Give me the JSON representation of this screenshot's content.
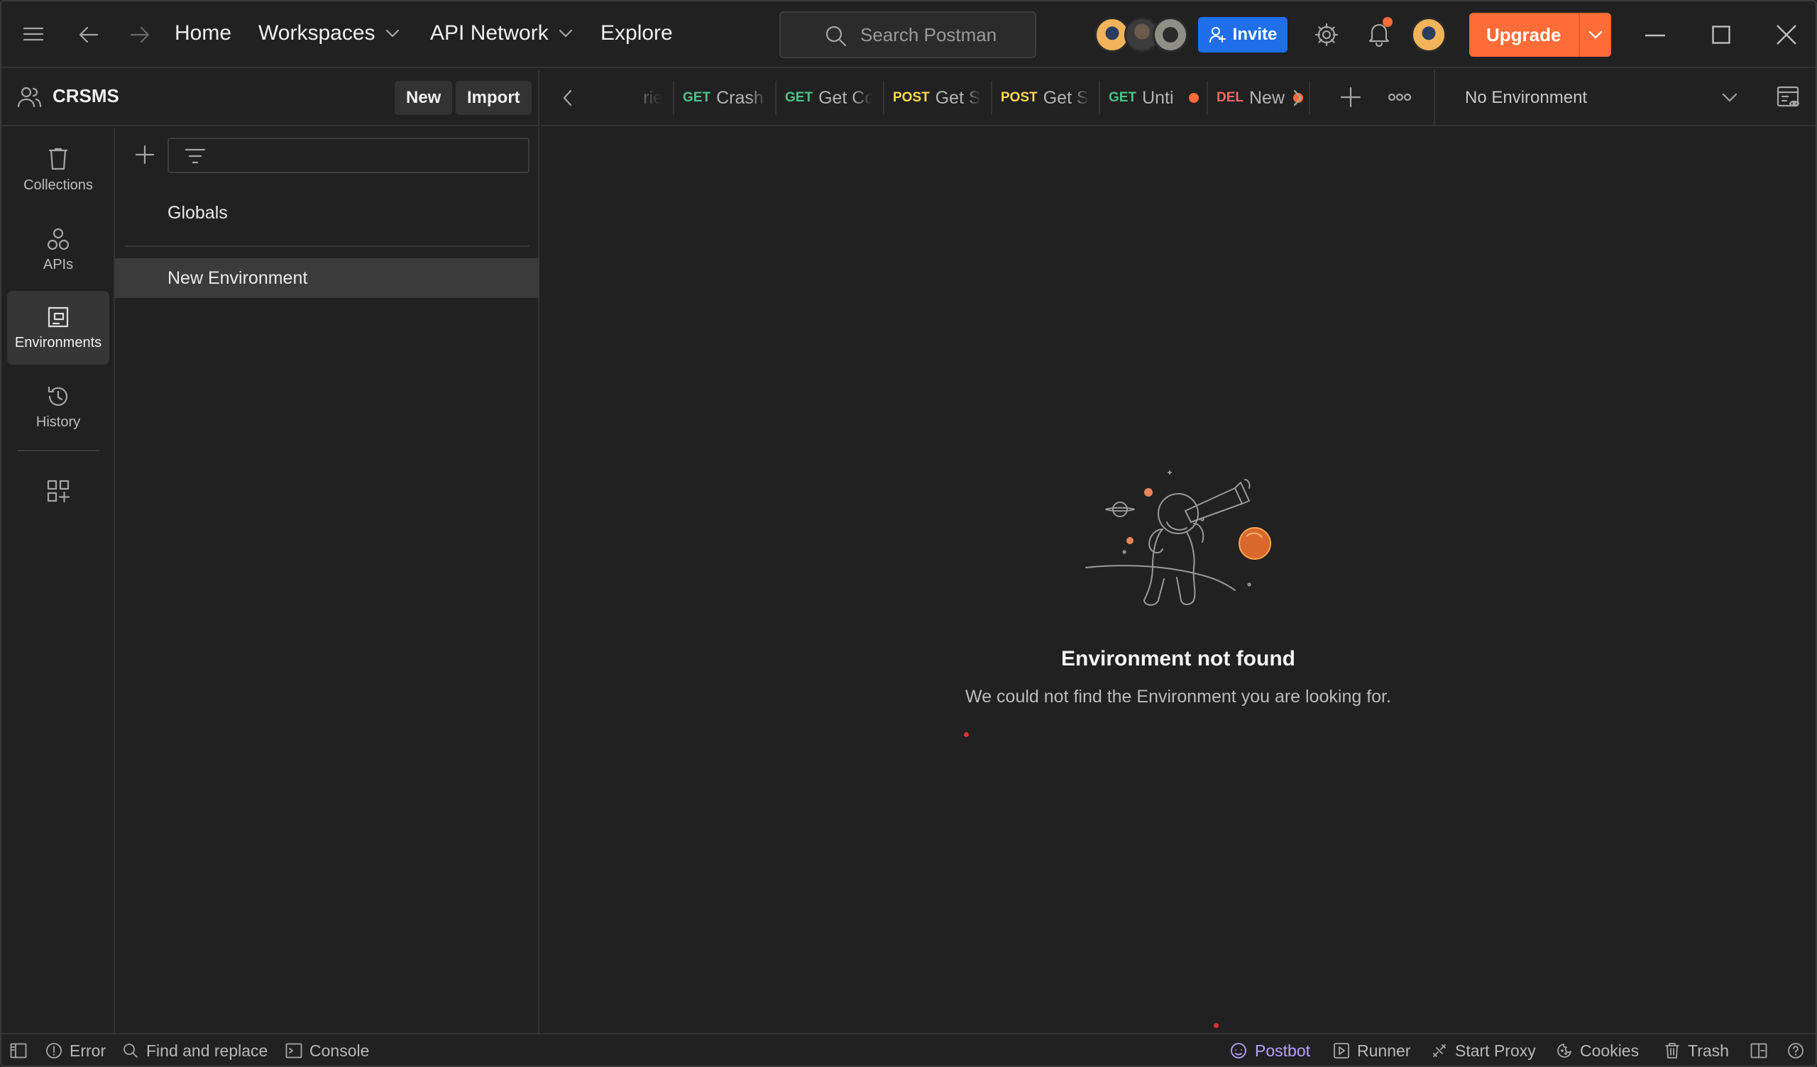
{
  "titlebar": {
    "nav": {
      "home": "Home",
      "workspaces": "Workspaces",
      "api_network": "API Network",
      "explore": "Explore"
    },
    "search_placeholder": "Search Postman",
    "invite_label": "Invite",
    "upgrade_label": "Upgrade"
  },
  "workspace": {
    "name": "CRSMS",
    "new_label": "New",
    "import_label": "Import"
  },
  "tabs": [
    {
      "method": "",
      "name": "rie",
      "unsaved": false
    },
    {
      "method": "GET",
      "name": "Crash R",
      "unsaved": false
    },
    {
      "method": "GET",
      "name": "Get Co",
      "unsaved": false
    },
    {
      "method": "POST",
      "name": "Get S",
      "unsaved": false
    },
    {
      "method": "POST",
      "name": "Get S",
      "unsaved": false
    },
    {
      "method": "GET",
      "name": "Unti",
      "unsaved": true
    },
    {
      "method": "DEL",
      "name": "New",
      "unsaved": true
    }
  ],
  "environment_selector": "No Environment",
  "rail": {
    "collections": "Collections",
    "apis": "APIs",
    "environments": "Environments",
    "history": "History"
  },
  "environments_list": [
    {
      "name": "Globals",
      "selected": false
    },
    {
      "name": "New Environment",
      "selected": true
    }
  ],
  "empty_state": {
    "title": "Environment not found",
    "message": "We could not find the Environment you are looking for."
  },
  "statusbar": {
    "error": "Error",
    "find_replace": "Find and replace",
    "console": "Console",
    "postbot": "Postbot",
    "runner": "Runner",
    "start_proxy": "Start Proxy",
    "cookies": "Cookies",
    "trash": "Trash"
  },
  "colors": {
    "accent_orange": "#ff6c37",
    "invite_blue": "#1f6fea",
    "get": "#4cc38a",
    "post": "#ffd84d",
    "delete": "#f06a6a"
  }
}
